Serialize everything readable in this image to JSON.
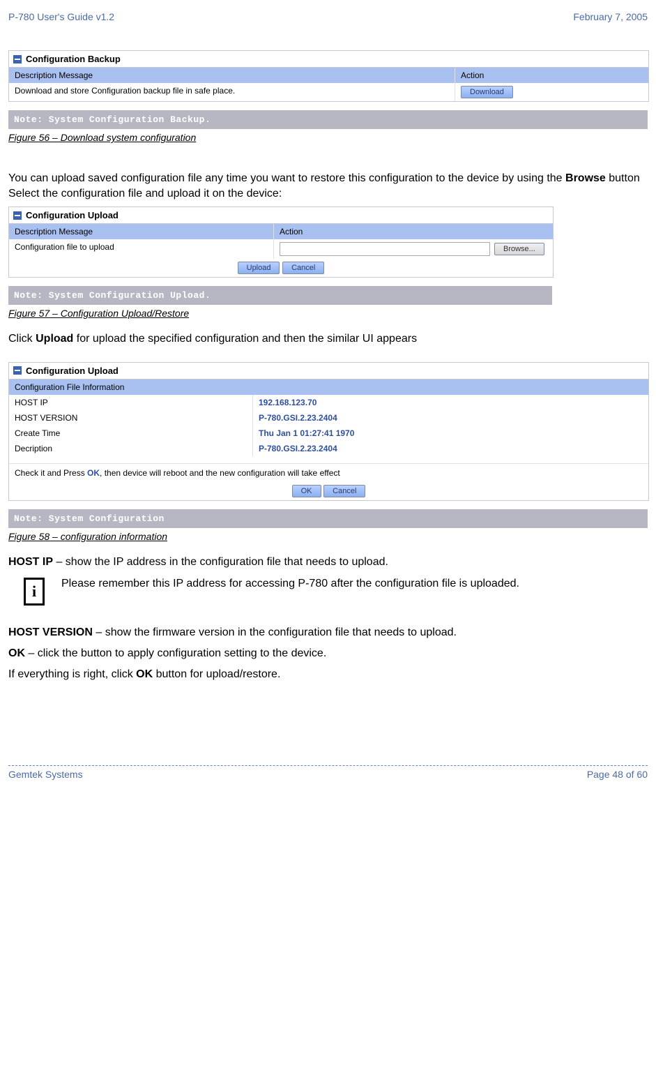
{
  "header": {
    "left": "P-780 User's Guide v1.2",
    "right": "February 7, 2005"
  },
  "panel1": {
    "title": "Configuration Backup",
    "hdr_desc": "Description Message",
    "hdr_action": "Action",
    "row_desc": "Download and store Configuration backup file in safe place.",
    "btn": "Download"
  },
  "note1": "Note: System Configuration Backup.",
  "fig56": "Figure 56 – Download system configuration",
  "para1_a": "You can upload saved configuration file any time you want to restore this configuration to the device by using the ",
  "para1_bold": "Browse",
  "para1_b": " button Select the configuration file and upload it on the device:",
  "panel2": {
    "title": "Configuration Upload",
    "hdr_desc": "Description Message",
    "hdr_action": "Action",
    "row_desc": "Configuration file to upload",
    "browse": "Browse...",
    "upload": "Upload",
    "cancel": "Cancel"
  },
  "note2": "Note: System Configuration Upload.",
  "fig57": "Figure 57 – Configuration Upload/Restore",
  "para2_a": "Click ",
  "para2_bold": "Upload",
  "para2_b": " for upload the specified configuration and then the similar UI appears",
  "panel3": {
    "title": "Configuration Upload",
    "subhdr": "Configuration File Information",
    "rows": [
      {
        "k": "HOST IP",
        "v": "192.168.123.70"
      },
      {
        "k": "HOST VERSION",
        "v": "P-780.GSI.2.23.2404"
      },
      {
        "k": "Create Time",
        "v": "Thu Jan 1 01:27:41 1970"
      },
      {
        "k": "Decription",
        "v": "P-780.GSI.2.23.2404"
      }
    ],
    "instruction_a": "Check it and Press ",
    "instruction_bold": "OK",
    "instruction_b": ", then device will reboot and the new configuration will take effect",
    "ok": "OK",
    "cancel": "Cancel"
  },
  "note3": "Note: System Configuration",
  "fig58": "Figure 58 – configuration information",
  "hostip_label": "HOST IP",
  "hostip_text": " – show the IP address in the configuration file that needs to upload.",
  "info_text": "Please remember this IP address for accessing P-780 after the configuration file is uploaded.",
  "hostver_label": "HOST VERSION",
  "hostver_text": " – show the firmware version in the configuration file that needs to upload.",
  "ok_label": "OK",
  "ok_text": " – click the button to apply configuration setting to the device.",
  "final_a": "If everything is right, click ",
  "final_bold": "OK",
  "final_b": " button for upload/restore.",
  "footer": {
    "left": "Gemtek Systems",
    "right": "Page 48 of 60"
  }
}
